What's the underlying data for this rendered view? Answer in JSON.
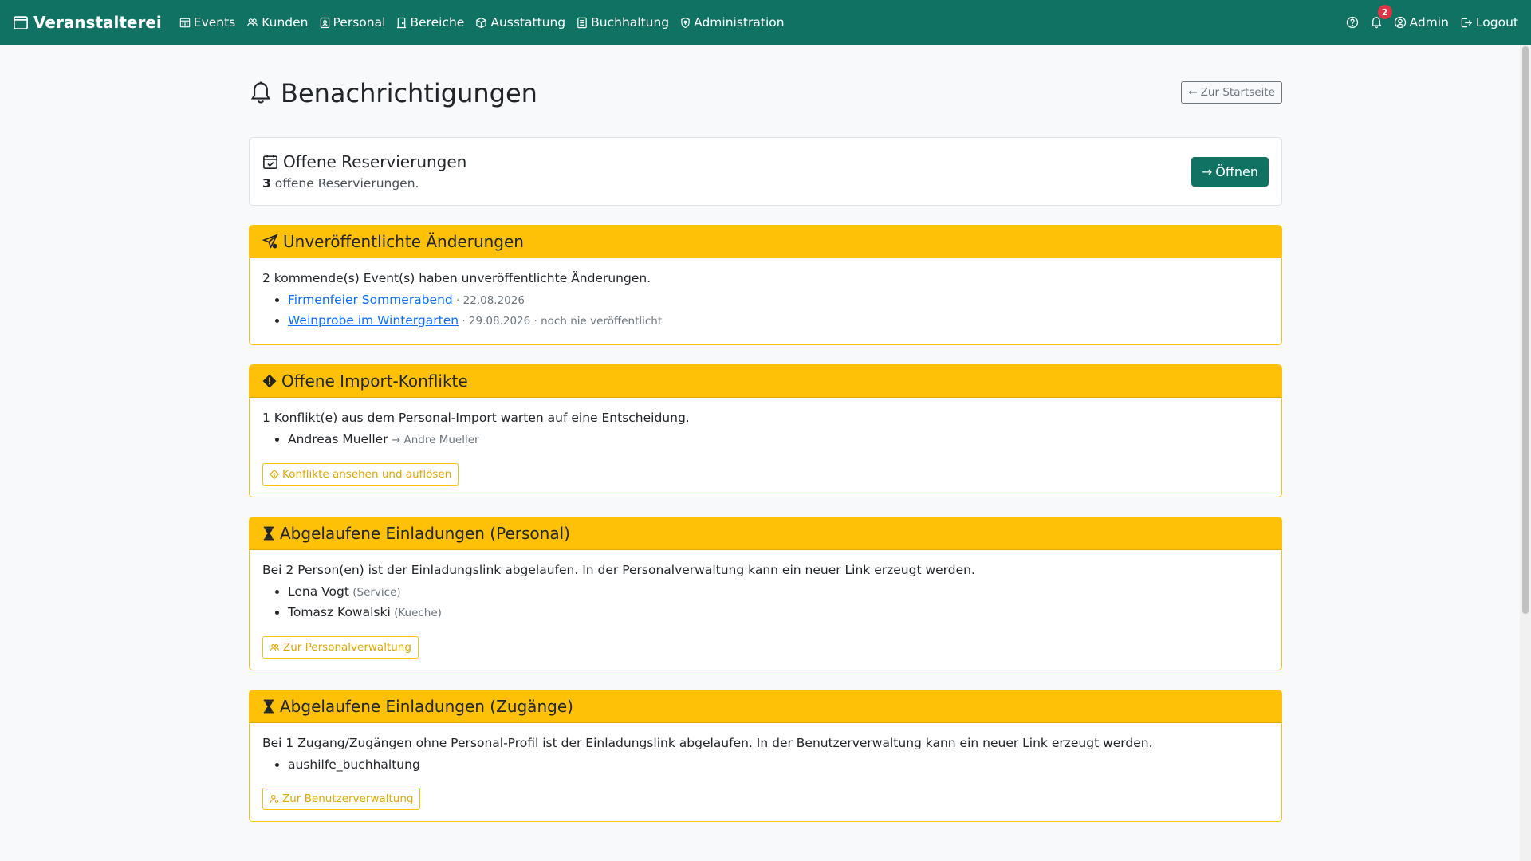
{
  "navbar": {
    "brand": "Veranstalterei",
    "items": [
      {
        "label": "Events"
      },
      {
        "label": "Kunden"
      },
      {
        "label": "Personal"
      },
      {
        "label": "Bereiche"
      },
      {
        "label": "Ausstattung"
      },
      {
        "label": "Buchhaltung"
      },
      {
        "label": "Administration"
      }
    ],
    "notification_count": "2",
    "user": "Admin",
    "logout": "Logout"
  },
  "page": {
    "title": "Benachrichtigungen",
    "back_button": "Zur Startseite"
  },
  "reservations": {
    "title": "Offene Reservierungen",
    "count": "3",
    "text": " offene Reservierungen.",
    "button": "Öffnen"
  },
  "unpublished": {
    "title": "Unveröffentlichte Änderungen",
    "text": "2 kommende(s) Event(s) haben unveröffentlichte Änderungen.",
    "events": [
      {
        "name": "Firmenfeier Sommerabend",
        "meta": " · 22.08.2026"
      },
      {
        "name": "Weinprobe im Wintergarten",
        "meta": " · 29.08.2026 · noch nie veröffentlicht"
      }
    ]
  },
  "conflicts": {
    "title": "Offene Import-Konflikte",
    "text": "1 Konflikt(e) aus dem Personal-Import warten auf eine Entscheidung.",
    "items": [
      {
        "name": "Andreas Mueller",
        "meta": " → Andre Mueller"
      }
    ],
    "button": "Konflikte ansehen und auflösen"
  },
  "expired_staff": {
    "title": "Abgelaufene Einladungen (Personal)",
    "text": "Bei 2 Person(en) ist der Einladungslink abgelaufen. In der Personalverwaltung kann ein neuer Link erzeugt werden.",
    "items": [
      {
        "name": "Lena Vogt",
        "meta": " (Service)"
      },
      {
        "name": "Tomasz Kowalski",
        "meta": " (Kueche)"
      }
    ],
    "button": "Zur Personalverwaltung"
  },
  "expired_access": {
    "title": "Abgelaufene Einladungen (Zugänge)",
    "text": "Bei 1 Zugang/Zugängen ohne Personal-Profil ist der Einladungslink abgelaufen. In der Benutzerverwaltung kann ein neuer Link erzeugt werden.",
    "items": [
      {
        "name": "aushilfe_buchhaltung"
      }
    ],
    "button": "Zur Benutzerverwaltung"
  },
  "colors": {
    "primary": "#0f7262",
    "warning": "#ffc107",
    "danger": "#dc3545",
    "link": "#0d6efd"
  }
}
